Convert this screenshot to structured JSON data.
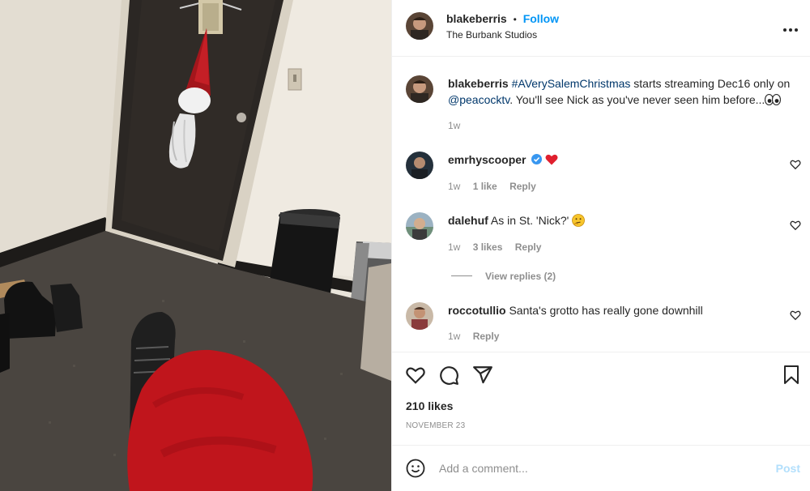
{
  "post": {
    "username": "blakeberris",
    "follow_label": "Follow",
    "dot": "•",
    "location": "The Burbank Studios",
    "more_icon": "more-horizontal-icon"
  },
  "caption": {
    "username": "blakeberris",
    "hashtag": "#AVerySalemChristmas",
    "text_a": " starts streaming Dec16 only on ",
    "mention": "@peacocktv",
    "text_b": ". You'll see Nick as you've never seen him before...",
    "emoji_icon": "eyes-emoji",
    "time": "1w"
  },
  "comments": [
    {
      "username": "emrhyscooper",
      "verified_icon": "verified-badge-icon",
      "text": "",
      "emoji_icon": "red-heart-emoji",
      "time": "1w",
      "likes": "1 like",
      "reply": "Reply"
    },
    {
      "username": "dalehuf",
      "text": "As in St. 'Nick?'",
      "emoji_icon": "thinking-face-emoji",
      "time": "1w",
      "likes": "3 likes",
      "reply": "Reply",
      "view_replies": "View replies (2)"
    },
    {
      "username": "roccotullio",
      "text": "Santa's grotto has really gone downhill",
      "time": "1w",
      "reply": "Reply"
    }
  ],
  "actions": {
    "likes": "210 likes",
    "date": "NOVEMBER 23"
  },
  "composer": {
    "placeholder": "Add a comment...",
    "post_label": "Post"
  },
  "colors": {
    "accent": "#0095f6",
    "text": "#262626",
    "muted": "#8e8e8e",
    "post_disabled": "#b2dffc"
  }
}
